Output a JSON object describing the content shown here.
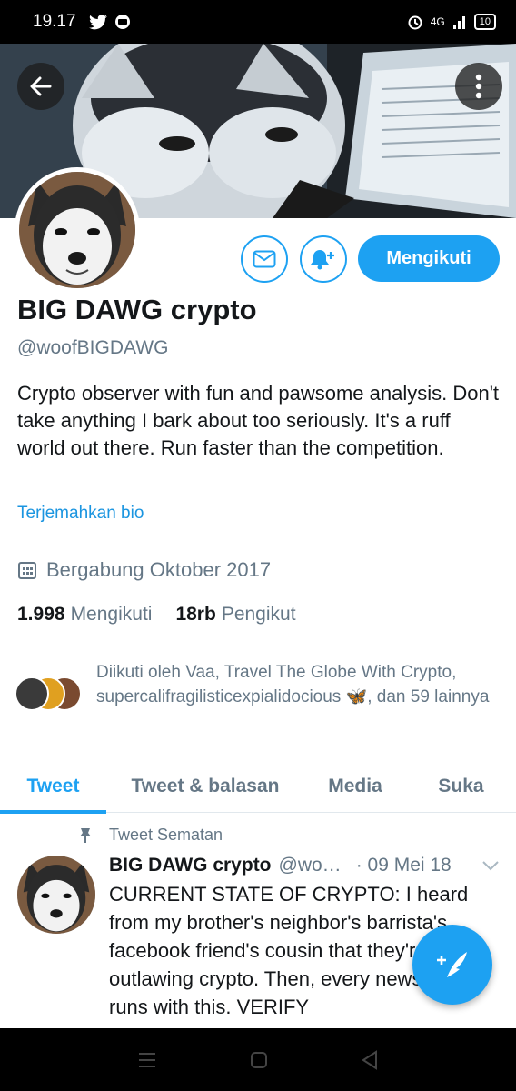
{
  "status_bar": {
    "time": "19.17",
    "network": "4G",
    "battery": "10"
  },
  "header": {
    "back_icon": "arrow-left-icon",
    "more_icon": "more-vertical-icon"
  },
  "profile": {
    "display_name": "BIG DAWG crypto",
    "handle": "@woofBIGDAWG",
    "bio": "Crypto observer with fun and pawsome analysis. Don't take anything I bark about too seriously. It's a ruff world out there. Run faster than the competition.",
    "translate_link": "Terjemahkan bio",
    "joined": "Bergabung Oktober 2017",
    "following_count": "1.998",
    "following_label": "Mengikuti",
    "followers_count": "18rb",
    "followers_label": "Pengikut",
    "followed_by": "Diikuti oleh Vaa, Travel The Globe With Crypto, supercalifragilisticexpialidocious 🦋, dan 59 lainnya"
  },
  "actions": {
    "follow_label": "Mengikuti",
    "message_icon": "mail-icon",
    "notify_icon": "bell-plus-icon"
  },
  "tabs": [
    {
      "label": "Tweet",
      "active": true
    },
    {
      "label": "Tweet & balasan",
      "active": false
    },
    {
      "label": "Media",
      "active": false
    },
    {
      "label": "Suka",
      "active": false
    }
  ],
  "tweet": {
    "pinned_label": "Tweet Sematan",
    "name": "BIG DAWG crypto",
    "handle": "@wo…",
    "date": "· 09 Mei 18",
    "text": "CURRENT STATE OF CRYPTO: I heard from my brother's neighbor's barrista's facebook friend's cousin that they're outlawing crypto. Then, every news outlet runs with this. VERIFY"
  },
  "colors": {
    "accent": "#1da1f2",
    "secondary_text": "#657786"
  }
}
